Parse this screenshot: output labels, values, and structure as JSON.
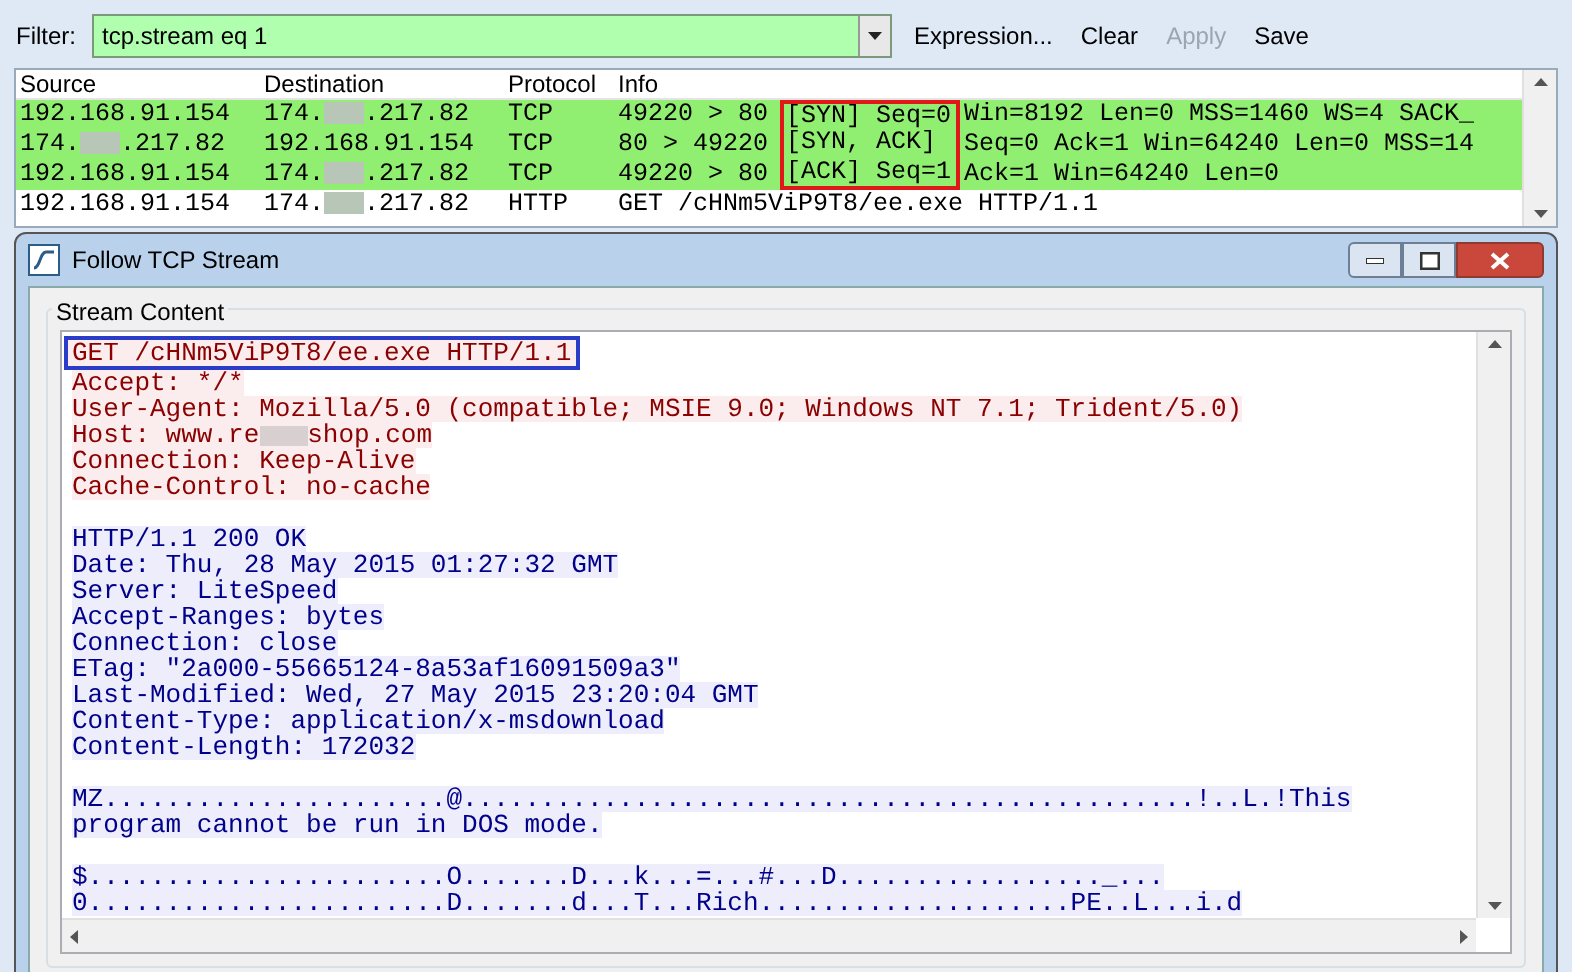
{
  "filter": {
    "label": "Filter:",
    "value": "tcp.stream eq 1",
    "buttons": [
      {
        "label": "Expression...",
        "disabled": false
      },
      {
        "label": "Clear",
        "disabled": false
      },
      {
        "label": "Apply",
        "disabled": true
      },
      {
        "label": "Save",
        "disabled": false
      }
    ]
  },
  "packet_list": {
    "columns": [
      "Source",
      "Destination",
      "Protocol",
      "Info"
    ],
    "rows": [
      {
        "source": {
          "head": "192.168.91.154"
        },
        "destination": {
          "head": "174.",
          "tail": ".217.82"
        },
        "protocol": "TCP",
        "info_ports": "49220 > 80",
        "info_flags": "[SYN] Seq=0",
        "info_rest": "Win=8192 Len=0 MSS=1460 WS=4 SACK_",
        "highlighted": true,
        "color": "#90ee70"
      },
      {
        "source": {
          "head": "174.",
          "tail": ".217.82"
        },
        "destination": {
          "head": "192.168.91.154"
        },
        "protocol": "TCP",
        "info_ports": "80 > 49220",
        "info_flags": "[SYN, ACK]",
        "info_rest": "Seq=0 Ack=1 Win=64240 Len=0 MSS=14",
        "highlighted": true,
        "color": "#90ee70"
      },
      {
        "source": {
          "head": "192.168.91.154"
        },
        "destination": {
          "head": "174.",
          "tail": ".217.82"
        },
        "protocol": "TCP",
        "info_ports": "49220 > 80",
        "info_flags": "[ACK] Seq=1",
        "info_rest": "Ack=1 Win=64240 Len=0",
        "highlighted": true,
        "color": "#90ee70"
      },
      {
        "source": {
          "head": "192.168.91.154"
        },
        "destination": {
          "head": "174.",
          "tail": ".217.82"
        },
        "protocol": "HTTP",
        "info_ports": "GET /cHNm5ViP9T8/ee.exe HTTP/1.1",
        "highlighted": false,
        "color": "#ffffff"
      }
    ]
  },
  "dialog": {
    "title": "Follow TCP Stream",
    "group_label": "Stream Content",
    "lines": [
      {
        "kind": "client",
        "text": "GET /cHNm5ViP9T8/ee.exe HTTP/1.1",
        "boxed": true
      },
      {
        "kind": "client",
        "text": "Accept: */*",
        "boxed": false
      },
      {
        "kind": "client",
        "text": "User-Agent: Mozilla/5.0 (compatible; MSIE 9.0; Windows NT 7.1; Trident/5.0)",
        "boxed": false
      },
      {
        "kind": "client",
        "text": "Host: www.re",
        "tail": "shop.com",
        "boxed": false
      },
      {
        "kind": "client",
        "text": "Connection: Keep-Alive",
        "boxed": false
      },
      {
        "kind": "client",
        "text": "Cache-Control: no-cache",
        "boxed": false
      },
      {
        "kind": "gap"
      },
      {
        "kind": "server",
        "text": "HTTP/1.1 200 OK",
        "boxed": false
      },
      {
        "kind": "server",
        "text": "Date: Thu, 28 May 2015 01:27:32 GMT",
        "boxed": false
      },
      {
        "kind": "server",
        "text": "Server: LiteSpeed",
        "boxed": false
      },
      {
        "kind": "server",
        "text": "Accept-Ranges: bytes",
        "boxed": false
      },
      {
        "kind": "server",
        "text": "Connection: close",
        "boxed": false
      },
      {
        "kind": "server",
        "text": "ETag: \"2a000-55665124-8a53af16091509a3\"",
        "boxed": false
      },
      {
        "kind": "server",
        "text": "Last-Modified: Wed, 27 May 2015 23:20:04 GMT",
        "boxed": false
      },
      {
        "kind": "server",
        "text": "Content-Type: application/x-msdownload",
        "boxed": false
      },
      {
        "kind": "server",
        "text": "Content-Length: 172032",
        "boxed": false
      },
      {
        "kind": "gap"
      },
      {
        "kind": "server",
        "text": "MZ......................@...............................................!..L.!This",
        "boxed": false
      },
      {
        "kind": "server",
        "text": "program cannot be run in DOS mode.",
        "boxed": false
      },
      {
        "kind": "gap"
      },
      {
        "kind": "server",
        "text": "$.......................O.......D...k...=...#...D................._...",
        "boxed": false
      },
      {
        "kind": "server",
        "text": "0.......................D.......d...T...Rich....................PE..L...i.d",
        "boxed": false
      }
    ]
  }
}
